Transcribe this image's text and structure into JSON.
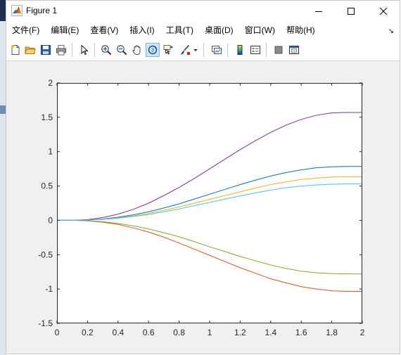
{
  "window": {
    "title": "Figure 1",
    "controls": {
      "minimize": "minimize",
      "maximize": "maximize",
      "close": "close"
    }
  },
  "menubar": {
    "items": [
      "文件(F)",
      "编辑(E)",
      "查看(V)",
      "插入(I)",
      "工具(T)",
      "桌面(D)",
      "窗口(W)",
      "帮助(H)"
    ]
  },
  "toolbar": {
    "buttons": [
      {
        "name": "new-figure",
        "icon": "new-file-icon"
      },
      {
        "name": "open-file",
        "icon": "folder-open-icon"
      },
      {
        "name": "save-figure",
        "icon": "save-icon"
      },
      {
        "name": "print-figure",
        "icon": "print-icon"
      },
      {
        "name": "edit-plot",
        "icon": "pointer-icon"
      },
      {
        "name": "zoom-in",
        "icon": "zoom-in-icon"
      },
      {
        "name": "zoom-out",
        "icon": "zoom-out-icon"
      },
      {
        "name": "pan",
        "icon": "hand-icon"
      },
      {
        "name": "rotate-3d",
        "icon": "rotate-icon",
        "active": true
      },
      {
        "name": "data-cursor",
        "icon": "data-cursor-icon"
      },
      {
        "name": "brush",
        "icon": "brush-icon"
      },
      {
        "name": "link-plot",
        "icon": "link-icon"
      },
      {
        "name": "insert-colorbar",
        "icon": "colorbar-icon"
      },
      {
        "name": "insert-legend",
        "icon": "legend-icon"
      },
      {
        "name": "hide-plot-tools",
        "icon": "hide-tools-icon"
      },
      {
        "name": "show-plot-tools",
        "icon": "show-tools-icon"
      }
    ]
  },
  "colors": {
    "series": [
      "#0072BD",
      "#D95319",
      "#EDB120",
      "#7E2F8E",
      "#77AC30",
      "#4DBEEE"
    ],
    "window_bg": "#f0f0f0",
    "axes_bg": "#ffffff"
  },
  "chart_data": {
    "type": "line",
    "title": "",
    "xlabel": "",
    "ylabel": "",
    "xlim": [
      0,
      2
    ],
    "ylim": [
      -1.5,
      2
    ],
    "xticks": [
      "0",
      "0.2",
      "0.4",
      "0.6",
      "0.8",
      "1",
      "1.2",
      "1.4",
      "1.6",
      "1.8",
      "2"
    ],
    "yticks": [
      "2",
      "1.5",
      "1",
      "0.5",
      "0",
      "-0.5",
      "-1",
      "-1.5"
    ],
    "grid": false,
    "legend": "none",
    "x": [
      0,
      0.1,
      0.2,
      0.3,
      0.4,
      0.5,
      0.6,
      0.7,
      0.8,
      0.9,
      1.0,
      1.1,
      1.2,
      1.3,
      1.4,
      1.5,
      1.6,
      1.7,
      1.8,
      1.9,
      2.0
    ],
    "series": [
      {
        "color": "#0072BD",
        "values": [
          0,
          0,
          0.005,
          0.02,
          0.045,
          0.08,
          0.125,
          0.18,
          0.24,
          0.31,
          0.38,
          0.45,
          0.52,
          0.585,
          0.645,
          0.695,
          0.735,
          0.765,
          0.78,
          0.785,
          0.785
        ]
      },
      {
        "color": "#D95319",
        "values": [
          0,
          0,
          -0.007,
          -0.028,
          -0.06,
          -0.11,
          -0.17,
          -0.245,
          -0.33,
          -0.42,
          -0.51,
          -0.6,
          -0.69,
          -0.77,
          -0.85,
          -0.91,
          -0.965,
          -1.0,
          -1.025,
          -1.035,
          -1.035
        ]
      },
      {
        "color": "#EDB120",
        "values": [
          0,
          0,
          0.004,
          0.016,
          0.035,
          0.065,
          0.1,
          0.145,
          0.195,
          0.25,
          0.305,
          0.36,
          0.415,
          0.47,
          0.52,
          0.56,
          0.595,
          0.615,
          0.63,
          0.635,
          0.635
        ]
      },
      {
        "color": "#7E2F8E",
        "values": [
          0,
          0,
          0.01,
          0.04,
          0.09,
          0.16,
          0.25,
          0.36,
          0.48,
          0.61,
          0.75,
          0.89,
          1.03,
          1.16,
          1.28,
          1.385,
          1.47,
          1.53,
          1.565,
          1.57,
          1.57
        ]
      },
      {
        "color": "#77AC30",
        "values": [
          0,
          0,
          -0.005,
          -0.02,
          -0.045,
          -0.08,
          -0.125,
          -0.18,
          -0.24,
          -0.31,
          -0.385,
          -0.455,
          -0.525,
          -0.59,
          -0.65,
          -0.7,
          -0.74,
          -0.765,
          -0.775,
          -0.78,
          -0.78
        ]
      },
      {
        "color": "#4DBEEE",
        "values": [
          0,
          0,
          0.003,
          0.013,
          0.03,
          0.055,
          0.085,
          0.125,
          0.165,
          0.215,
          0.26,
          0.31,
          0.355,
          0.4,
          0.44,
          0.475,
          0.5,
          0.515,
          0.525,
          0.53,
          0.53
        ]
      }
    ]
  }
}
